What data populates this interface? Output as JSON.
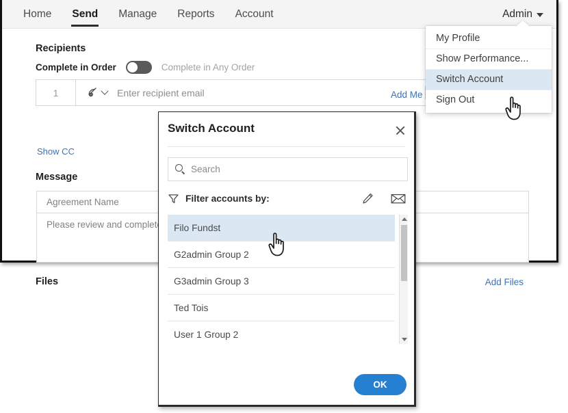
{
  "navbar": {
    "items": [
      {
        "label": "Home",
        "active": false
      },
      {
        "label": "Send",
        "active": true
      },
      {
        "label": "Manage",
        "active": false
      },
      {
        "label": "Reports",
        "active": false
      },
      {
        "label": "Account",
        "active": false
      }
    ],
    "account_menu_label": "Admin",
    "caret_icon": "chevron-down-icon"
  },
  "admin_dropdown": {
    "items": [
      {
        "label": "My Profile",
        "highlighted": false
      },
      {
        "label": "Show Performance...",
        "highlighted": false
      },
      {
        "label": "Switch Account",
        "highlighted": true
      },
      {
        "label": "Sign Out",
        "highlighted": false
      }
    ],
    "highlight_color": "#dbe8f3"
  },
  "send_page": {
    "recipients_title": "Recipients",
    "order_toggle": {
      "primary_label": "Complete in Order",
      "secondary_label": "Complete in Any Order",
      "state": "off",
      "track_color": "#5a5a5a"
    },
    "recipient_row": {
      "index": "1",
      "role_icon": "signature-pen-icon",
      "role_caret_icon": "chevron-down-icon",
      "email_placeholder": "Enter recipient email",
      "email_value": ""
    },
    "add_me_label": "Add Me",
    "show_cc_label": "Show CC",
    "message_title": "Message",
    "agreement_name_placeholder": "Agreement Name",
    "agreement_name_value": "",
    "message_body_value": "Please review and complete t",
    "files_title": "Files",
    "add_files_label": "Add Files",
    "link_color": "#3b73b9"
  },
  "switch_account_modal": {
    "title": "Switch Account",
    "close_icon": "close-icon",
    "search": {
      "placeholder": "Search",
      "value": "",
      "icon": "search-icon"
    },
    "filter": {
      "icon": "funnel-filter-icon",
      "label": "Filter accounts by:",
      "edit_icon": "pencil-icon",
      "email_icon": "envelope-icon"
    },
    "accounts": [
      {
        "name": "Filo Fundst",
        "selected": true
      },
      {
        "name": "G2admin Group 2",
        "selected": false
      },
      {
        "name": "G3admin Group 3",
        "selected": false
      },
      {
        "name": "Ted Tois",
        "selected": false
      },
      {
        "name": "User 1 Group 2",
        "selected": false
      }
    ],
    "scrollbar": {
      "up_icon": "scroll-up-arrow-icon",
      "down_icon": "scroll-down-arrow-icon"
    },
    "ok_label": "OK",
    "ok_color": "#2680d2",
    "selected_row_color": "#dbe8f3"
  },
  "cursors": [
    {
      "name": "pointer-hand-cursor-menu",
      "over": "Switch Account"
    },
    {
      "name": "pointer-hand-cursor-list",
      "over": "Filo Fundst"
    }
  ]
}
